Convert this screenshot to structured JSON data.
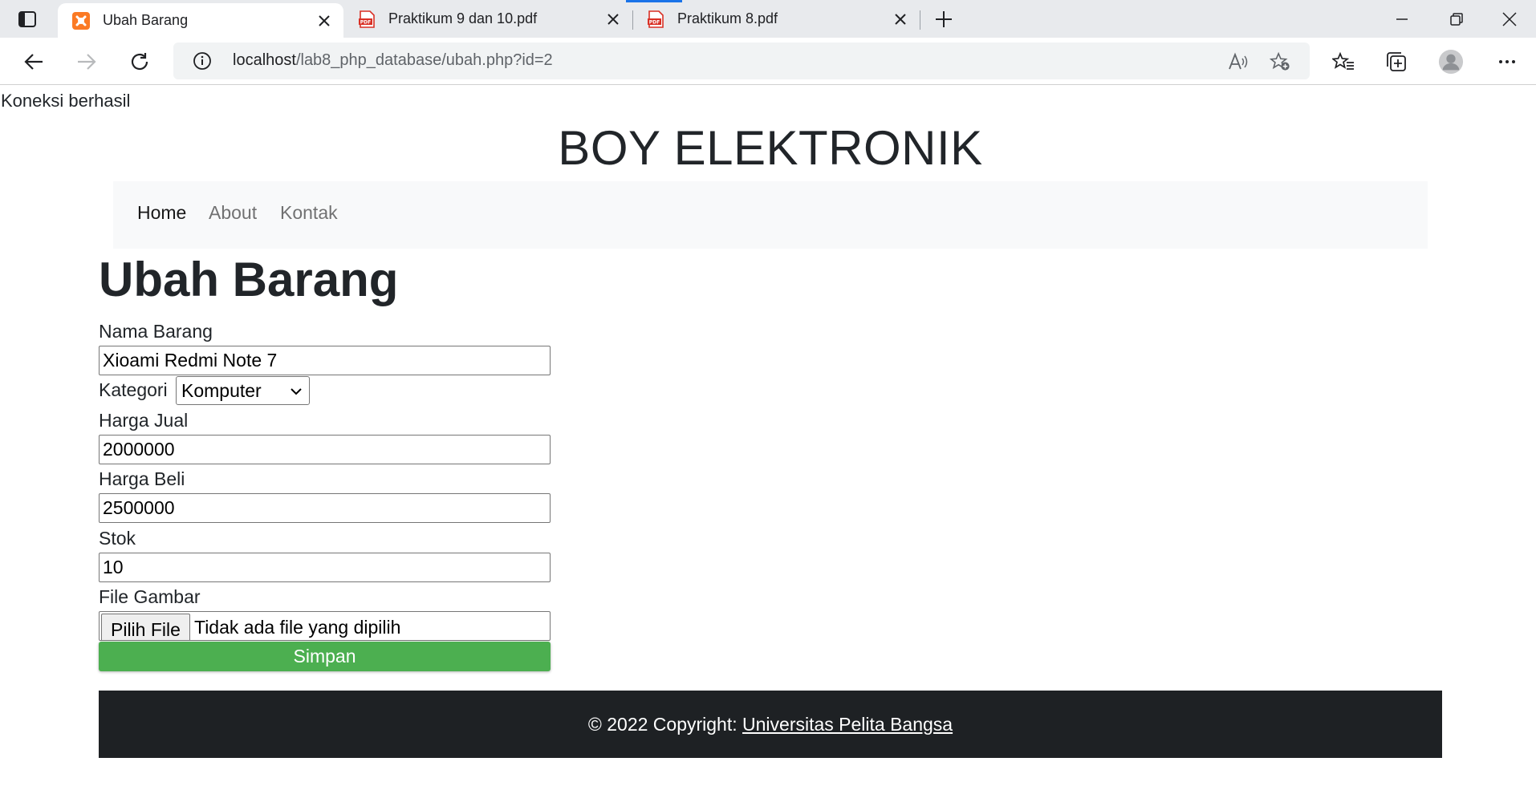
{
  "browser": {
    "tabs": [
      {
        "title": "Ubah Barang",
        "favicon": "xampp-icon",
        "active": true
      },
      {
        "title": "Praktikum 9 dan 10.pdf",
        "favicon": "pdf-icon",
        "active": false
      },
      {
        "title": "Praktikum 8.pdf",
        "favicon": "pdf-icon",
        "active": false
      }
    ],
    "url": {
      "host": "localhost",
      "path": "/lab8_php_database/ubah.php?id=2"
    },
    "colors": {
      "tabbar": "#e8eaed",
      "omnibox": "#f1f3f4",
      "pdf_red": "#d93025",
      "xampp_orange": "#fb7a24"
    }
  },
  "page": {
    "status": "Koneksi berhasil",
    "site_title": "BOY ELEKTRONIK",
    "nav": {
      "items": [
        {
          "label": "Home",
          "active": true
        },
        {
          "label": "About",
          "active": false
        },
        {
          "label": "Kontak",
          "active": false
        }
      ]
    },
    "form": {
      "title": "Ubah Barang",
      "nama_label": "Nama Barang",
      "nama_value": "Xioami Redmi Note 7",
      "kategori_label": "Kategori",
      "kategori_value": "Komputer",
      "harga_jual_label": "Harga Jual",
      "harga_jual_value": "2000000",
      "harga_beli_label": "Harga Beli",
      "harga_beli_value": "2500000",
      "stok_label": "Stok",
      "stok_value": "10",
      "file_label": "File Gambar",
      "file_button": "Pilih File",
      "file_status": "Tidak ada file yang dipilih",
      "submit": "Simpan",
      "submit_color": "#4caf50"
    },
    "footer": {
      "text": "© 2022 Copyright: ",
      "link": "Universitas Pelita Bangsa",
      "background": "#1e2124"
    }
  }
}
